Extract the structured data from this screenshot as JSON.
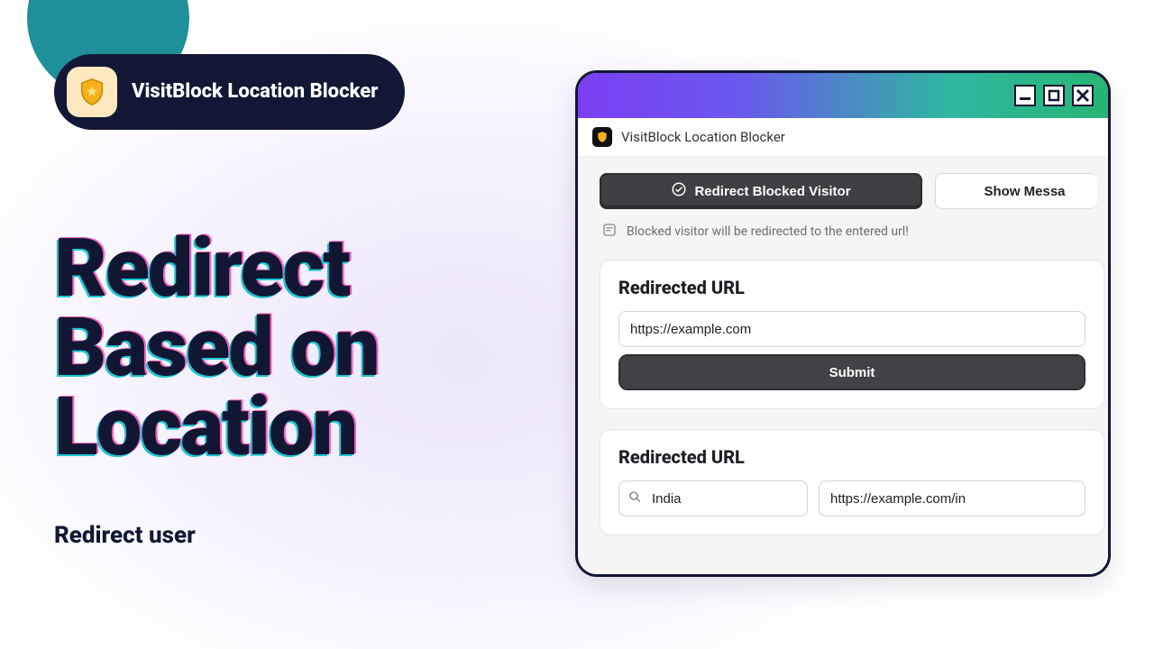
{
  "brand": {
    "name": "VisitBlock Location Blocker"
  },
  "hero": {
    "title": "Redirect Based on Location",
    "subtitle": "Redirect user"
  },
  "window": {
    "app_title": "VisitBlock Location Blocker",
    "tabs": {
      "redirect": "Redirect Blocked Visitor",
      "show_message": "Show Messa"
    },
    "hint": "Blocked visitor will be redirected to the entered url!",
    "section1": {
      "heading": "Redirected URL",
      "url_value": "https://example.com",
      "submit_label": "Submit"
    },
    "section2": {
      "heading": "Redirected URL",
      "country_value": "India",
      "url_value": "https://example.com/in"
    }
  }
}
